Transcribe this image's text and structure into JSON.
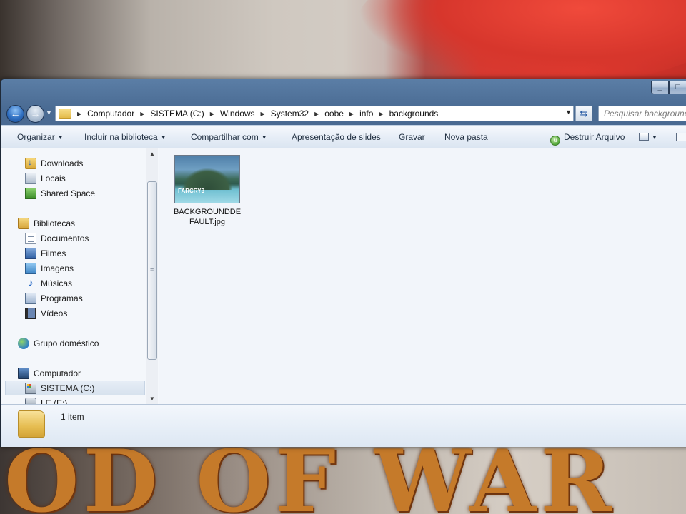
{
  "desktop": {
    "wallpaper_logo_text": "OD OF WAR"
  },
  "window": {
    "caption": {
      "minimize": "_",
      "maximize": "□"
    }
  },
  "address_bar": {
    "crumbs": [
      "Computador",
      "SISTEMA (C:)",
      "Windows",
      "System32",
      "oobe",
      "info",
      "backgrounds"
    ],
    "search_placeholder": "Pesquisar backgrounds"
  },
  "toolbar": {
    "organize": "Organizar",
    "include_library": "Incluir na biblioteca",
    "share_with": "Compartilhar com",
    "slideshow": "Apresentação de slides",
    "burn": "Gravar",
    "new_folder": "Nova pasta",
    "destroy_file": "Destruir Arquivo"
  },
  "nav_pane": {
    "items": [
      {
        "label": "Downloads",
        "icon": "downloads-folder-icon"
      },
      {
        "label": "Locais",
        "icon": "recent-places-icon"
      },
      {
        "label": "Shared Space",
        "icon": "shared-space-icon"
      },
      {
        "label": "Bibliotecas",
        "icon": "libraries-icon"
      },
      {
        "label": "Documentos",
        "icon": "documents-icon"
      },
      {
        "label": "Filmes",
        "icon": "movies-icon"
      },
      {
        "label": "Imagens",
        "icon": "pictures-icon"
      },
      {
        "label": "Músicas",
        "icon": "music-icon"
      },
      {
        "label": "Programas",
        "icon": "programs-icon"
      },
      {
        "label": "Vídeos",
        "icon": "videos-icon"
      },
      {
        "label": "Grupo doméstico",
        "icon": "homegroup-icon"
      },
      {
        "label": "Computador",
        "icon": "computer-icon"
      },
      {
        "label": "SISTEMA (C:)",
        "icon": "system-drive-icon",
        "selected": true
      },
      {
        "label": "LE (E:)",
        "icon": "removable-drive-icon"
      }
    ]
  },
  "content": {
    "files": [
      {
        "name": "BACKGROUNDDEFAULT.jpg",
        "thumb_label": "FARCRY3"
      }
    ]
  },
  "details_pane": {
    "item_count": "1 item"
  }
}
